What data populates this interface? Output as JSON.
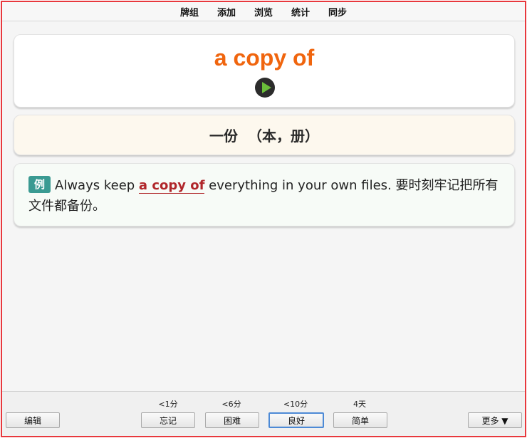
{
  "menu": {
    "items": [
      {
        "label": "牌组"
      },
      {
        "label": "添加"
      },
      {
        "label": "浏览"
      },
      {
        "label": "统计"
      },
      {
        "label": "同步"
      }
    ]
  },
  "card": {
    "word": "a copy of",
    "meaning": "一份  （本，册）",
    "example": {
      "badge": "例",
      "before": "Always keep ",
      "highlight": "a copy of",
      "after": " everything in your own files. 要时刻牢记把所有文件都备份。"
    }
  },
  "answer": {
    "intervals": [
      "<1分",
      "<6分",
      "<10分",
      "4天"
    ],
    "buttons": [
      "忘记",
      "困难",
      "良好",
      "简单"
    ]
  },
  "bottom": {
    "edit_label": "编辑",
    "more_label": "更多 ▼"
  },
  "icons": {
    "play": "play-icon"
  },
  "colors": {
    "word": "#f0650e",
    "highlight": "#b0262a",
    "badge": "#3a9a92",
    "frame": "#e8383d"
  }
}
